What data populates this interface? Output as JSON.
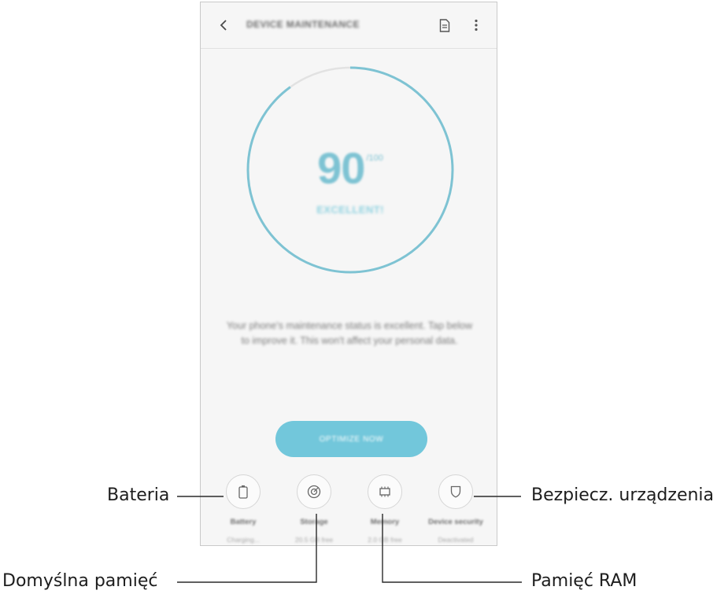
{
  "appbar": {
    "title": "DEVICE MAINTENANCE",
    "back_icon": "chevron-left-icon",
    "doc_icon": "document-icon",
    "more_icon": "more-vertical-icon"
  },
  "score": {
    "value": "90",
    "max": "/100",
    "status": "EXCELLENT!",
    "progress_fraction": 0.9,
    "ring_color": "#7ec3d3"
  },
  "status_message": "Your phone's maintenance status is excellent. Tap below to improve it. This won't affect your personal data.",
  "optimize_button": {
    "label": "OPTIMIZE NOW",
    "color": "#72c7db"
  },
  "tiles": [
    {
      "label": "Battery",
      "sub": "Charging...",
      "icon": "battery-icon"
    },
    {
      "label": "Storage",
      "sub": "20.5 GB free",
      "icon": "storage-icon"
    },
    {
      "label": "Memory",
      "sub": "2.0 GB free",
      "icon": "memory-chip-icon"
    },
    {
      "label": "Device security",
      "sub": "Deactivated",
      "icon": "shield-icon"
    }
  ],
  "callouts": {
    "battery": "Bateria",
    "storage": "Domyślna pamięć",
    "memory": "Pamięć RAM",
    "security": "Bezpiecz. urządzenia"
  }
}
